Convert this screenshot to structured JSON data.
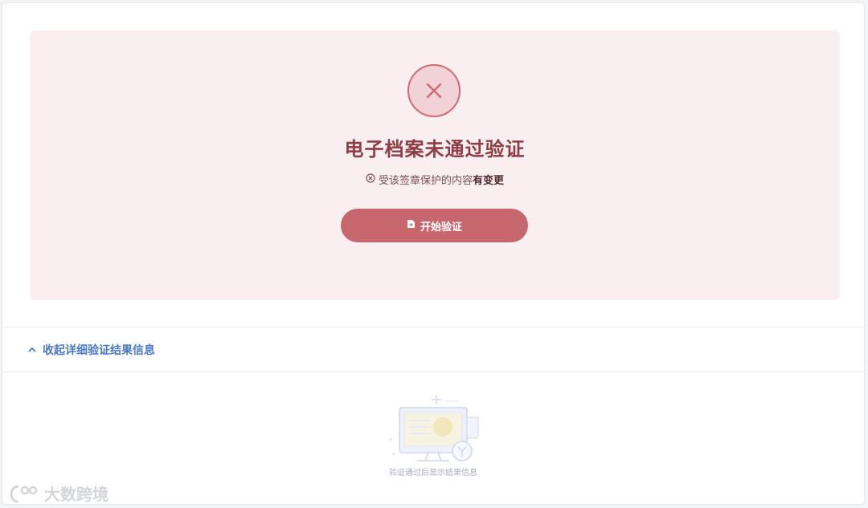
{
  "result": {
    "status": "failed",
    "title": "电子档案未通过验证",
    "subtitle_prefix": "受该签章保护的内容",
    "subtitle_emphasis": "有变更",
    "start_button_label": "开始验证"
  },
  "details": {
    "toggle_label": "收起详细验证结果信息",
    "empty_text": "验证通过后显示结果信息"
  },
  "watermark": {
    "text": "大数跨境"
  },
  "colors": {
    "panel_bg": "#f9eef0",
    "danger": "#c8666e",
    "title": "#8f3c44",
    "link": "#4a78c8"
  },
  "icons": {
    "status": "x-circle-icon",
    "subtitle": "x-small-circle-icon",
    "button": "document-icon",
    "toggle": "chevron-up-icon",
    "empty": "empty-monitor-illustration"
  }
}
